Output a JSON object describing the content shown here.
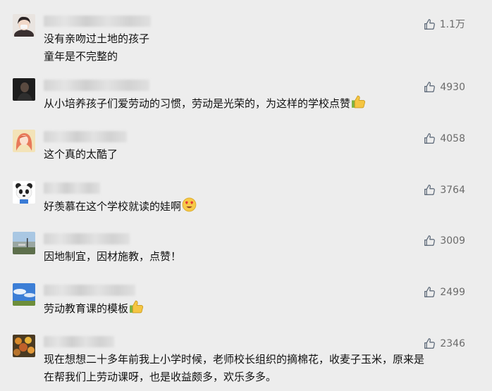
{
  "comments": [
    {
      "lines": [
        "没有亲吻过土地的孩子",
        "童年是不完整的"
      ],
      "likes": "1.1万",
      "avatar_icon": "girl-avatar-icon"
    },
    {
      "lines": [
        "从小培养孩子们爱劳动的习惯，劳动是光荣的，为这样的学校点赞"
      ],
      "emoji": "thumbs-up-emoji",
      "likes": "4930",
      "avatar_icon": "dark-portrait-avatar-icon"
    },
    {
      "lines": [
        "这个真的太酷了"
      ],
      "likes": "4058",
      "avatar_icon": "cartoon-girl-avatar-icon"
    },
    {
      "lines": [
        "好羡慕在这个学校就读的娃啊"
      ],
      "emoji": "heart-eyes-emoji",
      "likes": "3764",
      "avatar_icon": "panda-avatar-icon"
    },
    {
      "lines": [
        "因地制宜，因材施教，点赞！"
      ],
      "likes": "3009",
      "avatar_icon": "landscape-avatar-icon"
    },
    {
      "lines": [
        "劳动教育课的模板"
      ],
      "emoji": "thumbs-up-emoji",
      "likes": "2499",
      "avatar_icon": "sky-avatar-icon"
    },
    {
      "lines": [
        "现在想想二十多年前我上小学时候，老师校长组织的摘棉花，收麦子玉米，原来是",
        "在帮我们上劳动课呀，也是收益颇多，欢乐多多。"
      ],
      "likes": "2346",
      "avatar_icon": "flowers-avatar-icon"
    }
  ],
  "colors": {
    "background": "#ededed",
    "text": "#111111",
    "likes": "#6b6b6b",
    "icon": "#5f6b7a"
  }
}
